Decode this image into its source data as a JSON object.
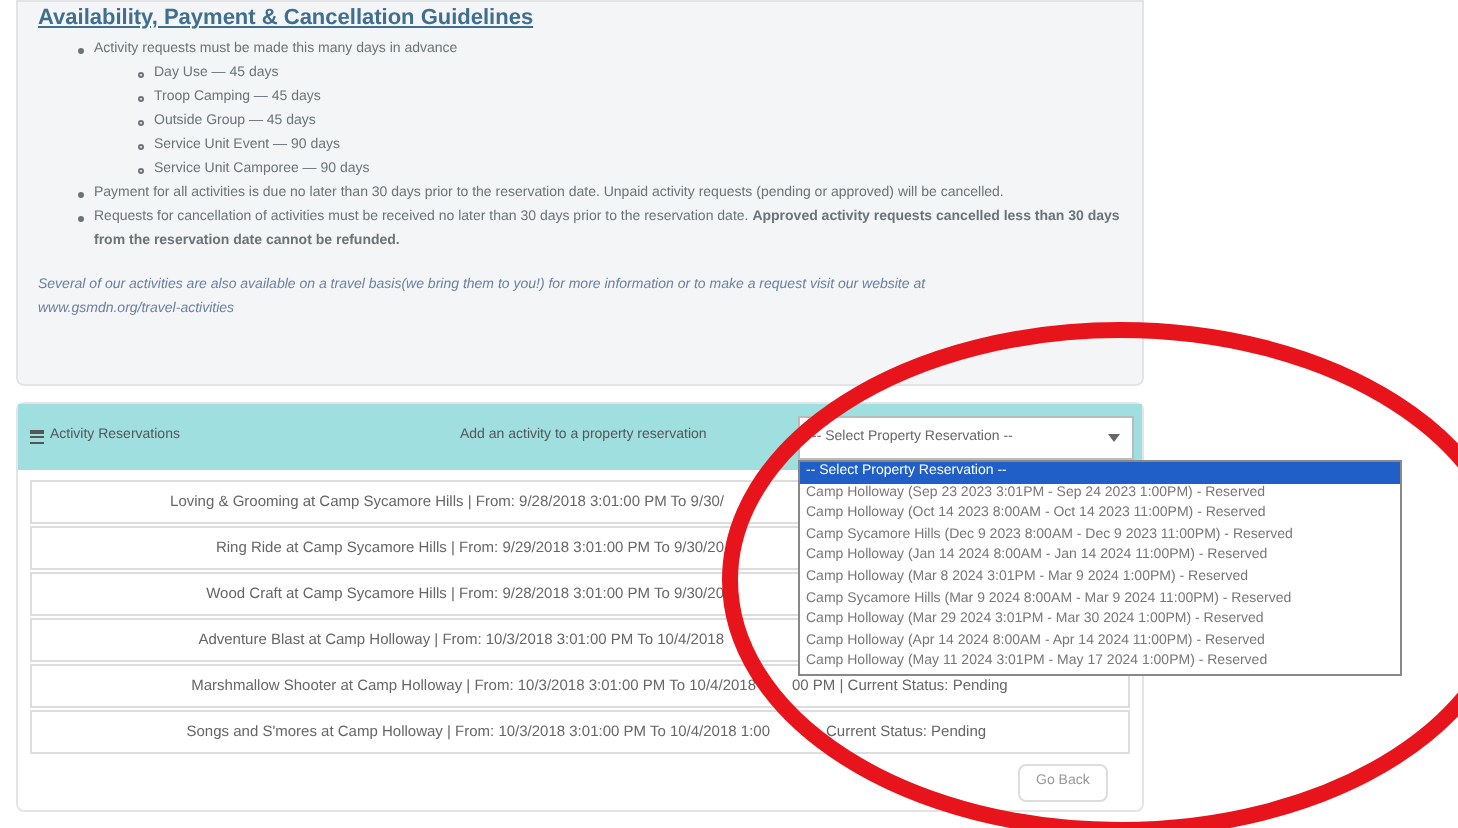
{
  "guidelines": {
    "title": "Availability, Payment & Cancellation Guidelines",
    "items": [
      {
        "text": "Activity requests must be made this many days in advance",
        "children": [
          {
            "text": "Day Use — 45 days"
          },
          {
            "text": "Troop Camping — 45 days"
          },
          {
            "text": "Outside Group — 45 days"
          },
          {
            "text": "Service Unit Event — 90 days"
          },
          {
            "text": "Service Unit Camporee — 90 days"
          }
        ]
      },
      {
        "text": "Payment for all activities is due no later than 30 days prior to the reservation date. Unpaid activity requests (pending or approved) will be cancelled."
      },
      {
        "text": "Requests for cancellation of activities must be received no later than 30 days prior to the reservation date. **Approved activity requests cancelled less than 30 days from the reservation date cannot be refunded.**"
      }
    ],
    "note": "Several of our activities are also available on a travel basis(we bring them to you!) for more information or to make a request visit our website at",
    "note_link": "www.gsmdn.org/travel-activities"
  },
  "reservations": {
    "title": "Activity Reservations",
    "add_label": "Add an activity to a property reservation",
    "select": {
      "value": "-- Select Property Reservation --",
      "expanded": true,
      "options": [
        {
          "label": "-- Select Property Reservation --",
          "selected": true
        },
        {
          "label": "Camp Holloway (Sep 23 2023 3:01PM - Sep 24 2023 1:00PM) - Reserved",
          "selected": false
        },
        {
          "label": "Camp Holloway (Oct 14 2023 8:00AM - Oct 14 2023 11:00PM) - Reserved",
          "selected": false
        },
        {
          "label": "Camp Sycamore Hills (Dec 9 2023 8:00AM - Dec 9 2023 11:00PM) - Reserved",
          "selected": false
        },
        {
          "label": "Camp Holloway (Jan 14 2024 8:00AM - Jan 14 2024 11:00PM) - Reserved",
          "selected": false
        },
        {
          "label": "Camp Holloway (Mar 8 2024 3:01PM - Mar 9 2024 1:00PM) - Reserved",
          "selected": false
        },
        {
          "label": "Camp Sycamore Hills (Mar 9 2024 8:00AM - Mar 9 2024 11:00PM) - Reserved",
          "selected": false
        },
        {
          "label": "Camp Holloway (Mar 29 2024 3:01PM - Mar 30 2024 1:00PM) - Reserved",
          "selected": false
        },
        {
          "label": "Camp Holloway (Apr 14 2024 8:00AM - Apr 14 2024 11:00PM) - Reserved",
          "selected": false
        },
        {
          "label": "Camp Holloway (May 11 2024 3:01PM - May 17 2024 1:00PM) - Reserved",
          "selected": false
        }
      ]
    },
    "rows": [
      {
        "text": "Loving & Grooming at Camp Sycamore Hills | From: 9/28/2018 3:01:00 PM To 9/30/"
      },
      {
        "text": "Ring Ride at Camp Sycamore Hills | From: 9/29/2018 3:01:00 PM To 9/30/20"
      },
      {
        "text": "Wood Craft at Camp Sycamore Hills | From: 9/28/2018 3:01:00 PM To 9/30/20"
      },
      {
        "text": "Adventure Blast at Camp Holloway | From: 10/3/2018 3:01:00 PM To 10/4/2018"
      },
      {
        "text": "Marshmallow Shooter at Camp Holloway | From: 10/3/2018 3:01:00 PM To 10/4/2018",
        "tail": "00 PM | Current Status: Pending"
      },
      {
        "text": "Songs and S'mores at Camp Holloway | From: 10/3/2018 3:01:00 PM To 10/4/2018 1:00",
        "tail": "Current Status: Pending"
      }
    ],
    "back_button": "Go Back"
  }
}
